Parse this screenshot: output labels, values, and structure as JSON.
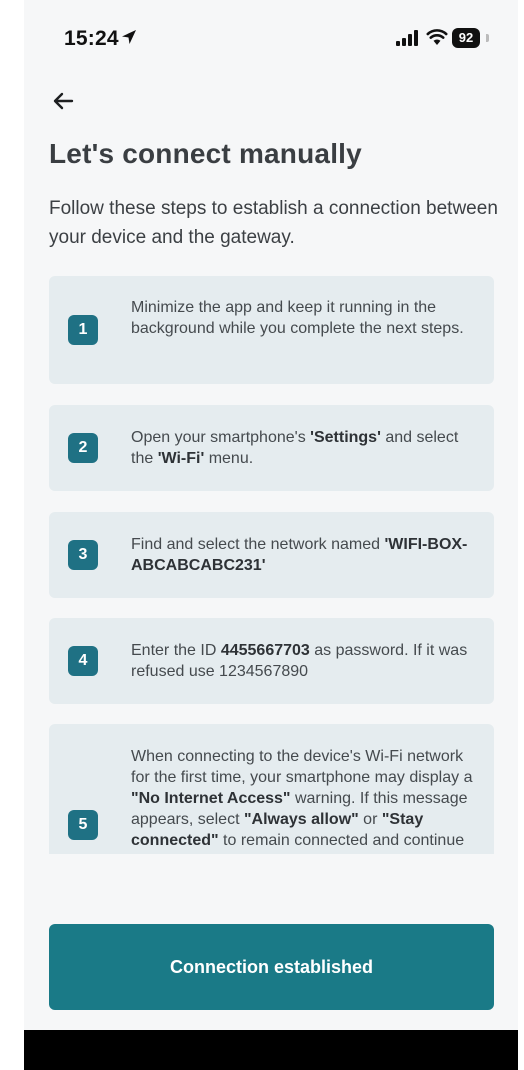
{
  "status_bar": {
    "time": "15:24",
    "battery": "92"
  },
  "header": {
    "title": "Let's connect manually",
    "subtitle": "Follow these steps to establish a connection between your device and the gateway."
  },
  "steps": [
    {
      "number": "1",
      "parts": [
        {
          "t": "Minimize the app and keep it running in the background while you complete the next steps."
        }
      ]
    },
    {
      "number": "2",
      "parts": [
        {
          "t": "Open your smartphone's "
        },
        {
          "t": "'Settings'",
          "b": true
        },
        {
          "t": " and select the "
        },
        {
          "t": "'Wi-Fi'",
          "b": true
        },
        {
          "t": " menu."
        }
      ]
    },
    {
      "number": "3",
      "parts": [
        {
          "t": "Find and select the network named "
        },
        {
          "t": "'WIFI-BOX-ABCABCABC231'",
          "b": true
        }
      ]
    },
    {
      "number": "4",
      "parts": [
        {
          "t": "Enter the ID "
        },
        {
          "t": "4455667703",
          "b": true
        },
        {
          "t": " as password. If it was refused use 1234567890"
        }
      ]
    },
    {
      "number": "5",
      "parts": [
        {
          "t": "When connecting to the device's Wi-Fi network for the first time, your smartphone may display a "
        },
        {
          "t": "\"No Internet Access\"",
          "b": true
        },
        {
          "t": " warning. If this message appears, select "
        },
        {
          "t": "\"Always allow\"",
          "b": true
        },
        {
          "t": " or "
        },
        {
          "t": "\"Stay connected\"",
          "b": true
        },
        {
          "t": " to remain connected and continue the setup process."
        }
      ]
    }
  ],
  "actions": {
    "primary_label": "Connection established"
  },
  "colors": {
    "accent": "#1a7a87",
    "badge": "#1f7184",
    "card_bg": "#e5ecef",
    "screen_bg": "#f6f7f8"
  },
  "icons": {
    "back": "arrow-left-icon",
    "location": "location-arrow-icon",
    "signal": "cellular-signal-icon",
    "wifi": "wifi-icon",
    "battery": "battery-icon"
  }
}
